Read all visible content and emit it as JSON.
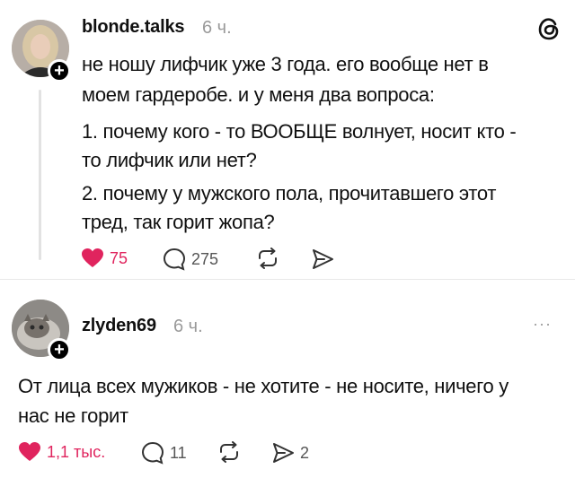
{
  "post1": {
    "username": "blonde.talks",
    "time": "6 ч.",
    "text_lines": [
      "не ношу лифчик уже 3 года. его вообще нет в",
      "моем гардеробе. и у меня два вопроса:"
    ],
    "q1_lines": [
      "1. почему кого - то ВООБЩЕ волнует, носит кто -",
      "то лифчик или нет?"
    ],
    "q2_lines": [
      "2. почему у мужского пола, прочитавшего этот",
      "тред, так горит жопа?"
    ],
    "likes": "75",
    "replies": "275"
  },
  "post2": {
    "username": "zlyden69",
    "time": "6 ч.",
    "text_lines": [
      "От лица всех мужиков - не хотите - не носите, ничего у",
      "нас не горит"
    ],
    "likes": "1,1 тыс.",
    "replies": "11",
    "shares": "2"
  },
  "icons": {
    "follow": "plus-icon",
    "logo": "threads-logo-icon",
    "like": "heart-icon",
    "reply": "comment-icon",
    "repost": "repost-icon",
    "share": "send-icon",
    "more": "more-icon"
  },
  "colors": {
    "like": "#e0245e",
    "muted": "#9a9a9a"
  },
  "plus_glyph": "+",
  "more_glyph": "···"
}
